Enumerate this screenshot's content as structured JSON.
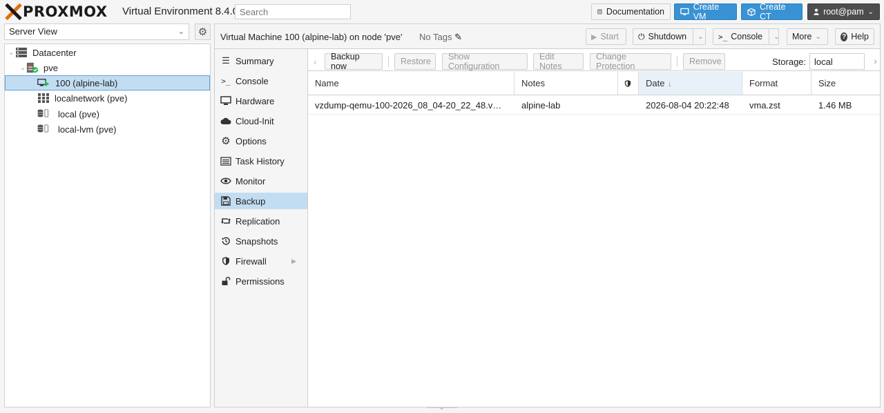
{
  "header": {
    "logo_text": "PROXMOX",
    "product_title": "Virtual Environment 8.4.0",
    "search_placeholder": "Search",
    "documentation_label": "Documentation",
    "create_vm_label": "Create VM",
    "create_ct_label": "Create CT",
    "user_label": "root@pam"
  },
  "sidebar": {
    "view_label": "Server View",
    "tree": [
      {
        "label": "Datacenter"
      },
      {
        "label": "pve"
      },
      {
        "label": "100 (alpine-lab)"
      },
      {
        "label": "localnetwork (pve)"
      },
      {
        "label": "local (pve)"
      },
      {
        "label": "local-lvm (pve)"
      }
    ]
  },
  "content": {
    "title": "Virtual Machine 100 (alpine-lab) on node 'pve'",
    "tags_label": "No Tags",
    "start_label": "Start",
    "shutdown_label": "Shutdown",
    "console_label": "Console",
    "more_label": "More",
    "help_label": "Help"
  },
  "nav": {
    "items": [
      {
        "label": "Summary",
        "icon": "summary-icon"
      },
      {
        "label": "Console",
        "icon": "terminal-icon"
      },
      {
        "label": "Hardware",
        "icon": "monitor-icon"
      },
      {
        "label": "Cloud-Init",
        "icon": "cloud-icon"
      },
      {
        "label": "Options",
        "icon": "gear-icon"
      },
      {
        "label": "Task History",
        "icon": "list-icon"
      },
      {
        "label": "Monitor",
        "icon": "eye-icon"
      },
      {
        "label": "Backup",
        "icon": "floppy-icon"
      },
      {
        "label": "Replication",
        "icon": "retweet-icon"
      },
      {
        "label": "Snapshots",
        "icon": "history-icon"
      },
      {
        "label": "Firewall",
        "icon": "shield-icon"
      },
      {
        "label": "Permissions",
        "icon": "unlock-icon"
      }
    ],
    "active": "Backup"
  },
  "backup": {
    "toolbar": {
      "backup_now": "Backup now",
      "restore": "Restore",
      "show_config": "Show Configuration",
      "edit_notes": "Edit Notes",
      "change_protection": "Change Protection",
      "remove": "Remove",
      "storage_label": "Storage:",
      "storage_value": "local"
    },
    "columns": {
      "name": "Name",
      "notes": "Notes",
      "date": "Date",
      "format": "Format",
      "size": "Size"
    },
    "rows": [
      {
        "name": "vzdump-qemu-100-2026_08_04-20_22_48.v…",
        "notes": "alpine-lab",
        "date": "2026-08-04 20:22:48",
        "format": "vma.zst",
        "size": "1.46 MB"
      }
    ]
  },
  "colors": {
    "accent_blue": "#3892d4",
    "selection": "#c2ddf2",
    "logo_orange": "#e57000",
    "status_green": "#21bf4b"
  }
}
